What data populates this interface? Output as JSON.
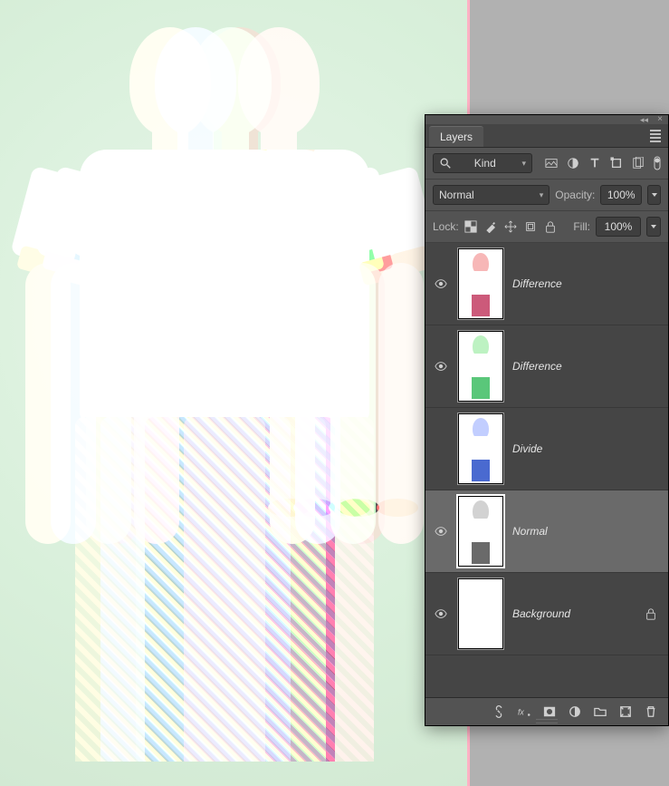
{
  "panel": {
    "tab": "Layers",
    "filter_kind": {
      "icon": "search",
      "label": "Kind"
    },
    "blend_mode": "Normal",
    "opacity_label": "Opacity:",
    "opacity_value": "100%",
    "lock_label": "Lock:",
    "fill_label": "Fill:",
    "fill_value": "100%"
  },
  "layers": [
    {
      "visible": true,
      "thumb": "red",
      "name": "Difference",
      "selected": false,
      "locked": false
    },
    {
      "visible": true,
      "thumb": "green",
      "name": "Difference",
      "selected": false,
      "locked": false
    },
    {
      "visible": false,
      "thumb": "blue",
      "name": "Divide",
      "selected": false,
      "locked": false
    },
    {
      "visible": true,
      "thumb": "bw",
      "name": "Normal",
      "selected": true,
      "locked": false
    },
    {
      "visible": true,
      "thumb": "white",
      "name": "Background",
      "selected": false,
      "locked": true
    }
  ]
}
